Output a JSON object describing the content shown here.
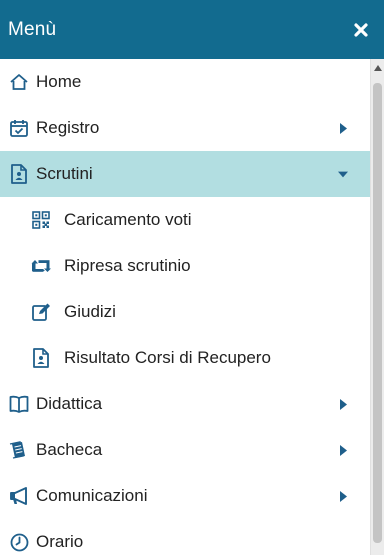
{
  "menu": {
    "title": "Menù",
    "items": [
      {
        "label": "Home"
      },
      {
        "label": "Registro"
      },
      {
        "label": "Scrutini"
      },
      {
        "label": "Caricamento voti"
      },
      {
        "label": "Ripresa scrutinio"
      },
      {
        "label": "Giudizi"
      },
      {
        "label": "Risultato Corsi di Recupero"
      },
      {
        "label": "Didattica"
      },
      {
        "label": "Bacheca"
      },
      {
        "label": "Comunicazioni"
      },
      {
        "label": "Orario"
      }
    ]
  },
  "colors": {
    "header_bg": "#126b8f",
    "active_bg": "#b2dee1",
    "icon_blue": "#1f5f8b"
  }
}
